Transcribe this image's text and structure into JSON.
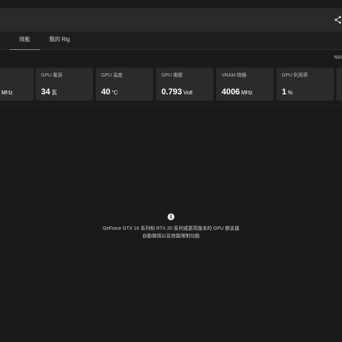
{
  "tabs": [
    {
      "label": "效能"
    },
    {
      "label": "我的 Rig"
    }
  ],
  "right_label": "NVI",
  "cards": [
    {
      "label": "",
      "value": "",
      "unit": "MHz"
    },
    {
      "label": "GPU 電源",
      "value": "34",
      "unit": "瓦"
    },
    {
      "label": "GPU 溫度",
      "value": "40",
      "unit": "°C"
    },
    {
      "label": "GPU 電壓",
      "value": "0.793",
      "unit": "Volt"
    },
    {
      "label": "VRAM 時鐘",
      "value": "4006",
      "unit": "MHz"
    },
    {
      "label": "GPU 利用率",
      "value": "1",
      "unit": "%"
    }
  ],
  "info": {
    "line1": "GeForce GTX 16 系列和 RTX 20 系列或更高版本的 GPU 都支援",
    "line2": "自動微調以及效能限制功能"
  },
  "colors": {
    "accent": "#76b900",
    "card_bg": "#2b2b2b",
    "bg": "#1a1a1a"
  }
}
